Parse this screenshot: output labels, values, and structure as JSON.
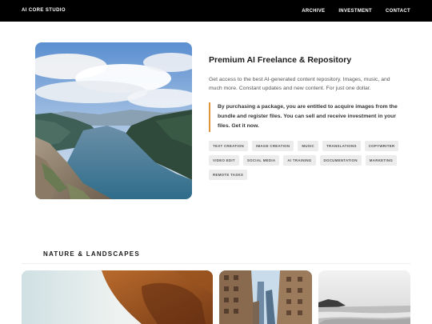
{
  "header": {
    "brand": "AI CORE STUDIO",
    "nav": [
      "ARCHIVE",
      "INVESTMENT",
      "CONTACT"
    ]
  },
  "product": {
    "title": "Premium AI Freelance & Repository",
    "description": "Get access to the best AI-generated content repository. Images, music, and much more. Constant updates and new content. For just one dollar.",
    "highlight": "By purchasing a package, you are entitled to acquire images from the bundle and register files. You can sell and receive investment in your files. Get it now.",
    "tags": [
      "TEXT CREATION",
      "IMAGE CREATION",
      "MUSIC",
      "TRANSLATIONS",
      "COPYWRITER",
      "VIDEO EDIT",
      "SOCIAL MEDIA",
      "AI TRAINING",
      "DOCUMENTATION",
      "MARKETING",
      "REMOTE TASKS"
    ]
  },
  "gallery": {
    "title": "NATURE & LANDSCAPES"
  },
  "colors": {
    "header_bg": "#000000",
    "accent": "#e2943e",
    "tag_bg": "#ececec"
  }
}
